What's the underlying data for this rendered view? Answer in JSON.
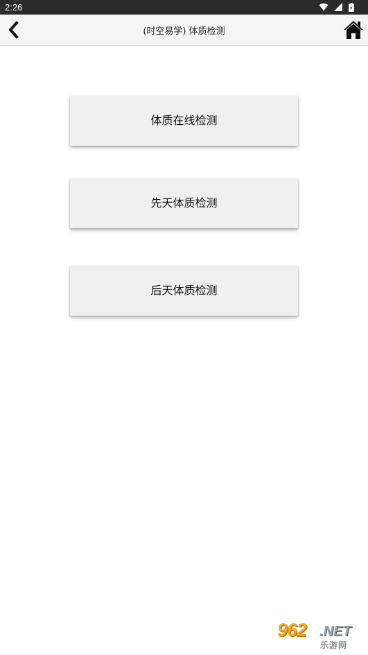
{
  "status_bar": {
    "time": "2:26",
    "icons": [
      "wifi-icon",
      "signal-icon",
      "battery-icon"
    ]
  },
  "app_bar": {
    "title": "(时空易学) 体质检测",
    "back_icon": "chevron-left-icon",
    "home_icon": "home-icon"
  },
  "menu": {
    "items": [
      {
        "label": "体质在线检测"
      },
      {
        "label": "先天体质检测"
      },
      {
        "label": "后天体质检测"
      }
    ]
  },
  "watermark": {
    "number": "962",
    "suffix": ".NET",
    "subtitle": "乐游网",
    "accent_color": "#f0a31d"
  }
}
